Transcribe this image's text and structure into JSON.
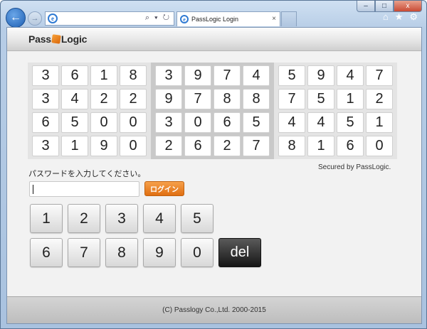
{
  "browser": {
    "tab_title": "PassLogic Login",
    "tab_close": "×",
    "back": "←",
    "forward": "→",
    "address_tools": "⌕ ▾ ↻",
    "window": {
      "minimize": "–",
      "maximize": "□",
      "close": "x"
    },
    "icons": {
      "home": "⌂",
      "favorites": "★",
      "tools": "⚙"
    }
  },
  "header": {
    "logo_left": "Pass",
    "logo_right": "Logic"
  },
  "matrix": {
    "blocks": [
      [
        [
          "3",
          "6",
          "1",
          "8"
        ],
        [
          "3",
          "4",
          "2",
          "2"
        ],
        [
          "6",
          "5",
          "0",
          "0"
        ],
        [
          "3",
          "1",
          "9",
          "0"
        ]
      ],
      [
        [
          "3",
          "9",
          "7",
          "4"
        ],
        [
          "9",
          "7",
          "8",
          "8"
        ],
        [
          "3",
          "0",
          "6",
          "5"
        ],
        [
          "2",
          "6",
          "2",
          "7"
        ]
      ],
      [
        [
          "5",
          "9",
          "4",
          "7"
        ],
        [
          "7",
          "5",
          "1",
          "2"
        ],
        [
          "4",
          "4",
          "5",
          "1"
        ],
        [
          "8",
          "1",
          "6",
          "0"
        ]
      ]
    ],
    "secured_text": "Secured by PassLogic."
  },
  "login": {
    "prompt": "パスワードを入力してください。",
    "password_value": "",
    "button_label": "ログイン"
  },
  "keypad": {
    "row1": [
      "1",
      "2",
      "3",
      "4",
      "5"
    ],
    "row2": [
      "6",
      "7",
      "8",
      "9",
      "0"
    ],
    "del_label": "del"
  },
  "footer": {
    "copyright": "(C) Passlogy Co.,Ltd. 2000-2015"
  },
  "colors": {
    "accent_orange": "#e06f12",
    "del_key": "#161616"
  }
}
